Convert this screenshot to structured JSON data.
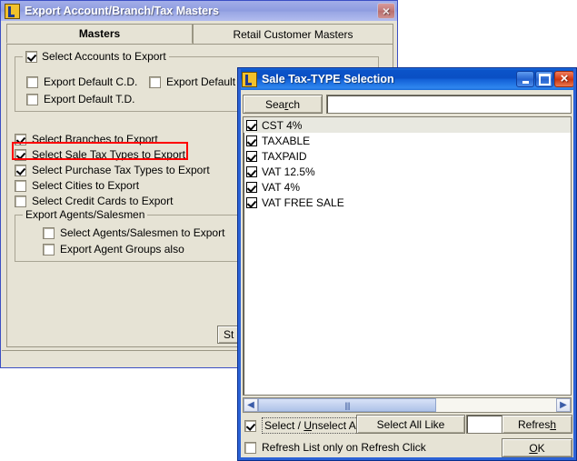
{
  "main_window": {
    "title": "Export Account/Branch/Tax Masters",
    "icon": "app-logo-icon",
    "close_label": "×",
    "tabs": [
      {
        "label": "Masters",
        "active": true
      },
      {
        "label": "Retail Customer Masters",
        "active": false
      }
    ],
    "accounts_group": {
      "legend": "Select Accounts to Export",
      "legend_checked": true,
      "options": [
        {
          "label": "Export Default C.D.",
          "checked": false
        },
        {
          "label": "Export Default Sp",
          "checked": false
        },
        {
          "label": "Export Default T.D.",
          "checked": false
        }
      ]
    },
    "export_options": [
      {
        "label": "Select Branches to Export",
        "checked": true,
        "highlighted": false
      },
      {
        "label": "Select Sale Tax Types to Export",
        "checked": true,
        "highlighted": true
      },
      {
        "label": "Select Purchase Tax Types to Export",
        "checked": true,
        "highlighted": false
      },
      {
        "label": "Select Cities to Export",
        "checked": false,
        "highlighted": false
      },
      {
        "label": "Select Credit Cards to Export",
        "checked": false,
        "highlighted": false
      }
    ],
    "agents_group": {
      "legend": "Export Agents/Salesmen",
      "options": [
        {
          "label": "Select Agents/Salesmen to Export",
          "checked": false
        },
        {
          "label": "Export Agent Groups also",
          "checked": false
        }
      ]
    },
    "start_button": "St"
  },
  "dialog": {
    "title": "Sale Tax-TYPE Selection",
    "icon": "app-logo-icon",
    "minimize_label": "",
    "maximize_label": "",
    "close_label": "×",
    "search": {
      "button_label": "Search",
      "button_accel": "r",
      "input_value": "",
      "input_placeholder": ""
    },
    "list_items": [
      {
        "label": "CST 4%",
        "checked": true,
        "selected": true
      },
      {
        "label": "TAXABLE",
        "checked": true,
        "selected": false
      },
      {
        "label": "TAXPAID",
        "checked": true,
        "selected": false
      },
      {
        "label": "VAT 12.5%",
        "checked": true,
        "selected": false
      },
      {
        "label": "VAT 4%",
        "checked": true,
        "selected": false
      },
      {
        "label": "VAT FREE SALE",
        "checked": true,
        "selected": false
      }
    ],
    "scrollbar": {
      "left_arrow": "◀",
      "right_arrow": "▶",
      "grip": "||||"
    },
    "footer": {
      "select_unselect_all_label": "Select / Unselect All",
      "select_unselect_all_checked": true,
      "select_all_like_label": "Select All Like",
      "select_all_like_value": "",
      "refresh_label": "Refresh",
      "refresh_only_label": "Refresh List only on Refresh Click",
      "refresh_only_checked": false,
      "ok_label": "OK"
    }
  },
  "colors": {
    "active_title": "#0a4fc4",
    "inactive_title": "#8e9ce0",
    "window_face": "#e6e3d5",
    "annotation": "#ff0000",
    "dialog_border": "#2b62d6"
  }
}
